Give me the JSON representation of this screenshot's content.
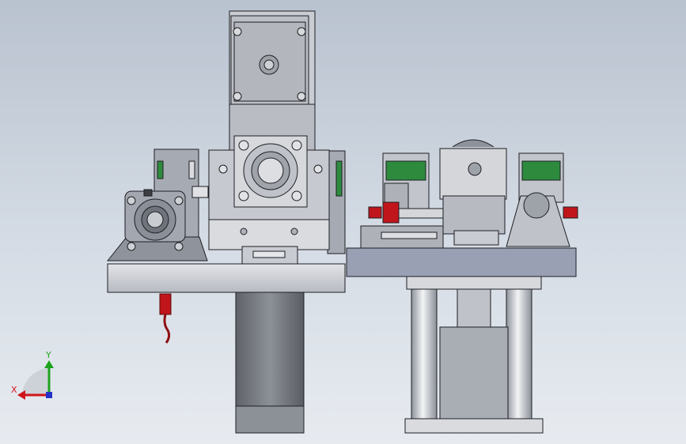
{
  "viewport": {
    "background_top": "#b9c2cf",
    "background_bottom": "#e7ebf0"
  },
  "parts": {
    "stepper_motor_top": "stepper-motor",
    "bearing_housing_center": "flange-bearing",
    "pillow_block_left": "pillow-block-bearing",
    "linear_guides": "linear-guide-rail",
    "lower_motor": "servo-motor",
    "right_station": "clamping-station",
    "support_columns": "guide-columns"
  },
  "colors": {
    "steel_light": "#d3d6dc",
    "steel_mid": "#a9adb5",
    "steel_dark": "#6d7078",
    "plate_blue": "#9aa0b4",
    "green_slider": "#2e8b3e",
    "red_part": "#c0161b",
    "edge": "#1e1f24"
  },
  "triad": {
    "x_label": "X",
    "y_label": "Y",
    "x_color": "#d1141b",
    "y_color": "#1ea31e",
    "z_color": "#2432c8"
  }
}
